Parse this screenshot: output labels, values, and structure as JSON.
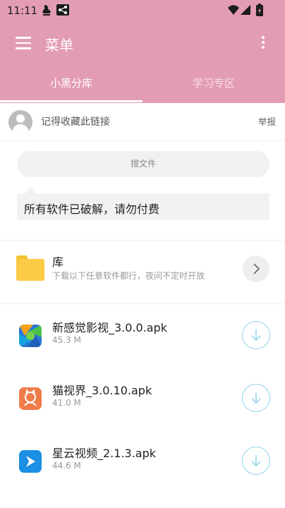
{
  "status_bar": {
    "time": "11:11"
  },
  "toolbar": {
    "title": "菜单"
  },
  "tabs": [
    {
      "label": "小黑分库",
      "active": true
    },
    {
      "label": "学习专区",
      "active": false
    }
  ],
  "notice_row": {
    "text": "记得收藏此链接",
    "report_label": "举报"
  },
  "search": {
    "label": "搜文件"
  },
  "announcement": {
    "text": "所有软件已破解，请勿付费"
  },
  "folder": {
    "name": "库",
    "description": "下载以下任意软件都行，夜间不定时开放"
  },
  "files": [
    {
      "name": "新感觉影视_3.0.0.apk",
      "size": "45.3 M",
      "icon": "new-feeling-video-app-icon"
    },
    {
      "name": "猫视界_3.0.10.apk",
      "size": "41.0 M",
      "icon": "cat-vision-app-icon"
    },
    {
      "name": "星云视频_2.1.3.apk",
      "size": "44.6 M",
      "icon": "nebula-video-app-icon"
    }
  ],
  "colors": {
    "primary": "#e39cb6",
    "download_ring": "#8fd2ea",
    "folder": "#fbcb45"
  }
}
